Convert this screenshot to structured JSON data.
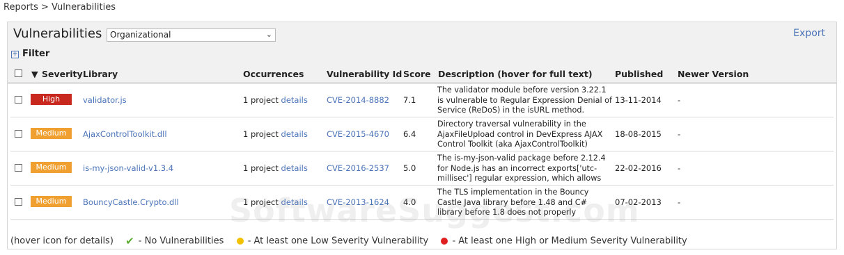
{
  "breadcrumb": "Reports > Vulnerabilities",
  "page": {
    "title": "Vulnerabilities",
    "scope_value": "Organizational",
    "export_label": "Export",
    "filter_label": "Filter"
  },
  "table": {
    "headers": {
      "severity": "Severity",
      "library": "Library",
      "occurrences": "Occurrences",
      "vuln_id": "Vulnerability Id",
      "score": "Score",
      "description": "Description (hover for full text)",
      "published": "Published",
      "newer": "Newer Version"
    },
    "rows": [
      {
        "severity": "High",
        "library": "validator.js",
        "occ_count": "1 project",
        "occ_link": "details",
        "vuln_id": "CVE-2014-8882",
        "score": "7.1",
        "description": "The validator module before version 3.22.1 is vulnerable to Regular Expression Denial of Service (ReDoS) in the isURL method.",
        "published": "13-11-2014",
        "newer": "-"
      },
      {
        "severity": "Medium",
        "library": "AjaxControlToolkit.dll",
        "occ_count": "1 project",
        "occ_link": "details",
        "vuln_id": "CVE-2015-4670",
        "score": "6.4",
        "description": "Directory traversal vulnerability in the AjaxFileUpload control in DevExpress AJAX Control Toolkit (aka AjaxControlToolkit)",
        "published": "18-08-2015",
        "newer": "-"
      },
      {
        "severity": "Medium",
        "library": "is-my-json-valid-v1.3.4",
        "occ_count": "1 project",
        "occ_link": "details",
        "vuln_id": "CVE-2016-2537",
        "score": "5.0",
        "description": "The is-my-json-valid package before 2.12.4 for Node.js has an incorrect exports['utc-millisec'] regular expression, which allows",
        "published": "22-02-2016",
        "newer": "-"
      },
      {
        "severity": "Medium",
        "library": "BouncyCastle.Crypto.dll",
        "occ_count": "1 project",
        "occ_link": "details",
        "vuln_id": "CVE-2013-1624",
        "score": "4.0",
        "description": "The TLS implementation in the Bouncy Castle Java library before 1.48 and C# library before 1.8 does not properly",
        "published": "07-02-2013",
        "newer": "-"
      }
    ]
  },
  "legend": {
    "hint": "(hover icon for details)",
    "none": "- No Vulnerabilities",
    "low": "- At least one Low Severity Vulnerability",
    "high": "- At least one High or Medium Severity Vulnerability"
  },
  "watermark": "SoftwareSuggest.com",
  "colors": {
    "high": "#c8281e",
    "medium": "#f0a030",
    "link": "#4a73b8",
    "ok": "#5cad2f",
    "low_dot": "#f2c200",
    "high_dot": "#e02020"
  }
}
